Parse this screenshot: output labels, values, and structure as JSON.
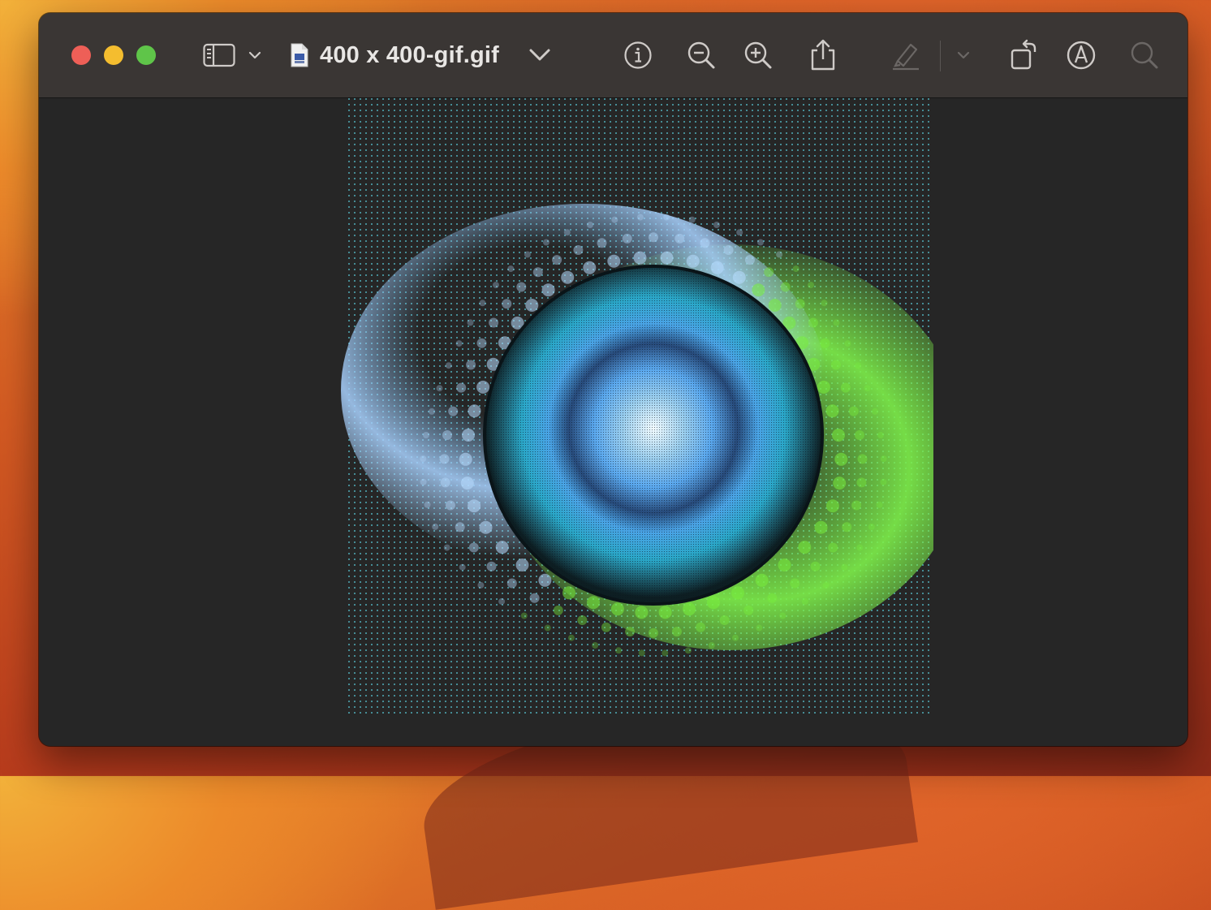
{
  "window": {
    "document_title": "400 x 400-gif.gif"
  },
  "toolbar": {
    "buttons": [
      {
        "name": "sidebar-toggle",
        "icon": "sidebar-icon"
      },
      {
        "name": "sidebar-menu",
        "icon": "chevron-down-icon"
      },
      {
        "name": "title-menu",
        "icon": "chevron-down-icon"
      },
      {
        "name": "info",
        "icon": "info-icon"
      },
      {
        "name": "zoom-out",
        "icon": "zoom-out-icon"
      },
      {
        "name": "zoom-in",
        "icon": "zoom-in-icon"
      },
      {
        "name": "share",
        "icon": "share-icon"
      },
      {
        "name": "highlight",
        "icon": "highlighter-icon",
        "enabled": false
      },
      {
        "name": "highlight-menu",
        "icon": "chevron-down-icon",
        "enabled": false
      },
      {
        "name": "rotate",
        "icon": "rotate-icon"
      },
      {
        "name": "markup",
        "icon": "markup-icon"
      },
      {
        "name": "search",
        "icon": "search-icon",
        "enabled": false
      }
    ]
  },
  "colors": {
    "titlebar": "#3a3634",
    "content_bg": "#262626",
    "icon": "#cfcbc8",
    "icon_disabled": "#6b6765",
    "close": "#ee5f57",
    "minimize": "#f4bd2f",
    "maximize": "#5fc549",
    "image_blue": "#5aa8ee",
    "image_green": "#78ee3c",
    "image_cyan": "#60e0f0"
  }
}
